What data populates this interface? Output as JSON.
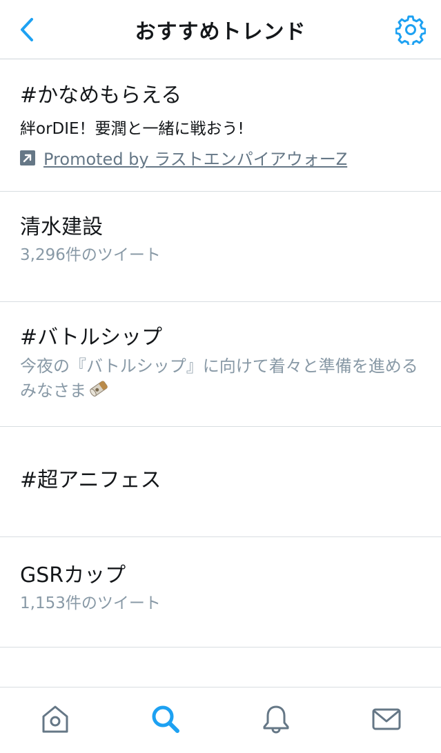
{
  "header": {
    "title": "おすすめトレンド",
    "back_icon": "chevron-left-icon",
    "settings_icon": "gear-icon"
  },
  "trends": [
    {
      "name": "#かなめもらえる",
      "description": "絆orDIE！要潤と一緒に戦おう!",
      "promoted_text": "Promoted by ラストエンパイアウォーZ",
      "promoted_icon": "promoted-arrow-icon"
    },
    {
      "name": "清水建設",
      "count": "3,296件のツイート"
    },
    {
      "name": "#バトルシップ",
      "context": "今夜の『バトルシップ』に向けて着々と準備を進めるみなさま",
      "context_emoji": "bullet-emoji"
    },
    {
      "name": "#超アニフェス"
    },
    {
      "name": "GSRカップ",
      "count": "1,153件のツイート"
    }
  ],
  "tabbar": {
    "active_tab": "search",
    "tabs": [
      "home",
      "search",
      "notifications",
      "messages"
    ]
  },
  "colors": {
    "accent": "#1da1f2",
    "text": "#14171a",
    "muted": "#8899a6",
    "divider": "#d8dde1",
    "icon_inactive": "#657786"
  }
}
